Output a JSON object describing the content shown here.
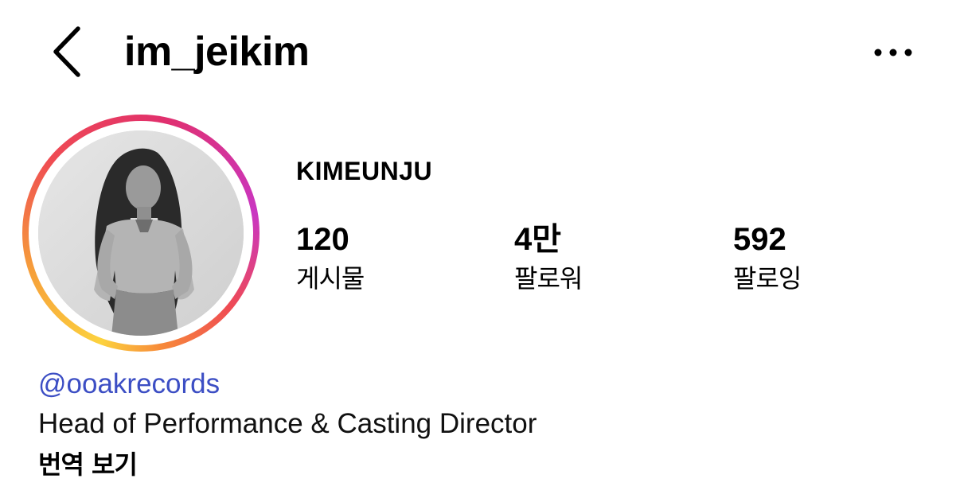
{
  "header": {
    "back_icon": "chevron-left-icon",
    "username": "im_jeikim",
    "more_icon": "more-horizontal-icon"
  },
  "profile": {
    "avatar_icon": "profile-photo",
    "story_ring_colors": [
      "#fcd23e",
      "#f6a03a",
      "#ef4b53",
      "#e1306c",
      "#c936c2"
    ],
    "display_name": "KIMEUNJU",
    "stats": [
      {
        "count": "120",
        "label": "게시물"
      },
      {
        "count": "4만",
        "label": "팔로워"
      },
      {
        "count": "592",
        "label": "팔로잉"
      }
    ]
  },
  "bio": {
    "mention": "@ooakrecords",
    "mention_color": "#3c4ec4",
    "text": "Head of Performance & Casting Director",
    "translate_label": "번역 보기"
  }
}
